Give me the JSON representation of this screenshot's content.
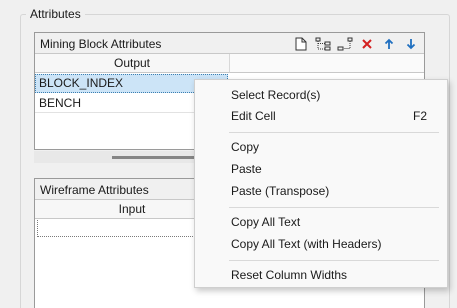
{
  "group": {
    "label": "Attributes"
  },
  "mining_panel": {
    "title": "Mining Block Attributes",
    "column_header": "Output",
    "rows": [
      {
        "text": "BLOCK_INDEX",
        "selected": true
      },
      {
        "text": "BENCH",
        "selected": false
      }
    ],
    "toolbar_icons": [
      "new-document-icon",
      "expand-tree-icon",
      "collapse-tree-icon",
      "delete-icon",
      "move-up-icon",
      "move-down-icon"
    ]
  },
  "wireframe_panel": {
    "title": "Wireframe Attributes",
    "column_header": "Input"
  },
  "context_menu": {
    "items": [
      {
        "label": "Select Record(s)",
        "shortcut": ""
      },
      {
        "label": "Edit Cell",
        "shortcut": "F2"
      },
      {
        "label": "Copy",
        "shortcut": ""
      },
      {
        "label": "Paste",
        "shortcut": ""
      },
      {
        "label": "Paste (Transpose)",
        "shortcut": ""
      },
      {
        "label": "Copy All Text",
        "shortcut": ""
      },
      {
        "label": "Copy All Text (with Headers)",
        "shortcut": ""
      },
      {
        "label": "Reset Column Widths",
        "shortcut": ""
      }
    ]
  },
  "colors": {
    "delete": "#d42020",
    "arrows": "#1f6fc0",
    "selection": "#cce4f7"
  }
}
